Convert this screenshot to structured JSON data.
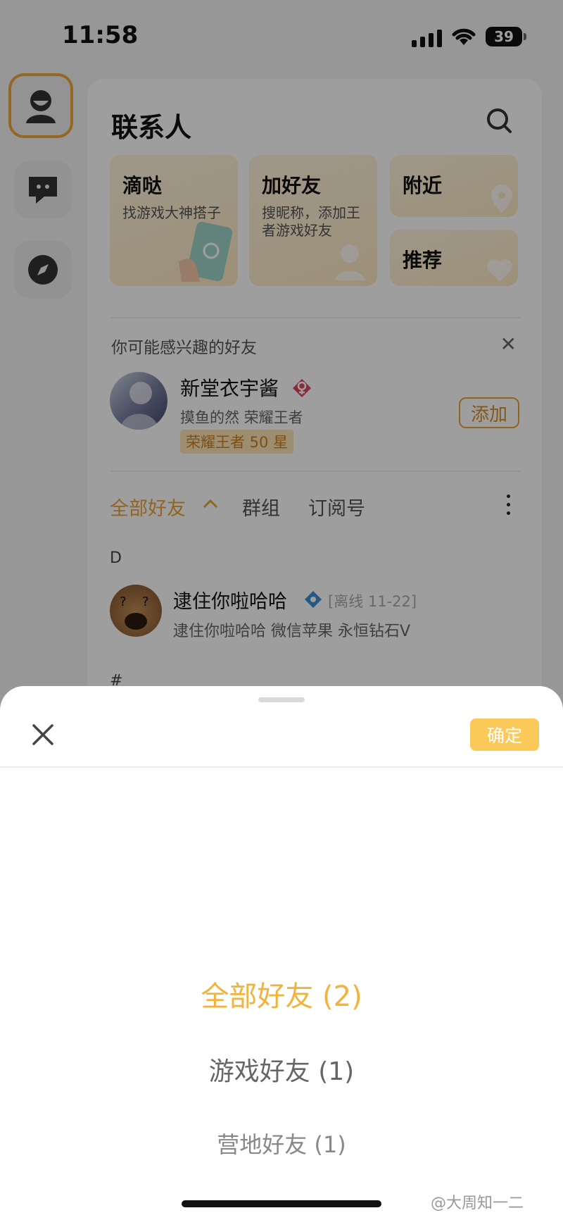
{
  "status_bar": {
    "time": "11:58",
    "battery": "39"
  },
  "contacts": {
    "title": "联系人",
    "tiles": [
      {
        "title": "滴哒",
        "subtitle": "找游戏大神搭子"
      },
      {
        "title": "加好友",
        "subtitle": "搜昵称，添加王者游戏好友"
      },
      {
        "title": "附近"
      },
      {
        "title": "推荐"
      }
    ],
    "suggest": {
      "label": "你可能感兴趣的好友",
      "name": "新堂衣宇酱",
      "detail": "摸鱼的然 荣耀王者",
      "rank": "荣耀王者 50 星",
      "add_label": "添加"
    },
    "tabs": {
      "all": "全部好友",
      "groups": "群组",
      "subscriptions": "订阅号"
    },
    "section_letter": "D",
    "friend": {
      "name": "逮住你啦哈哈",
      "status": "[离线 11-22]",
      "detail": "逮住你啦哈哈 微信苹果 永恒钻石Ⅴ"
    },
    "next_section": "#"
  },
  "sheet": {
    "confirm_label": "确定",
    "options": [
      {
        "label": "全部好友 (2)",
        "selected": true
      },
      {
        "label": "游戏好友 (1)",
        "selected": false
      },
      {
        "label": "营地好友 (1)",
        "selected": false
      }
    ]
  },
  "watermark": "@大周知一二",
  "colors": {
    "accent": "#f2b33c",
    "confirm": "#fbc95a"
  }
}
